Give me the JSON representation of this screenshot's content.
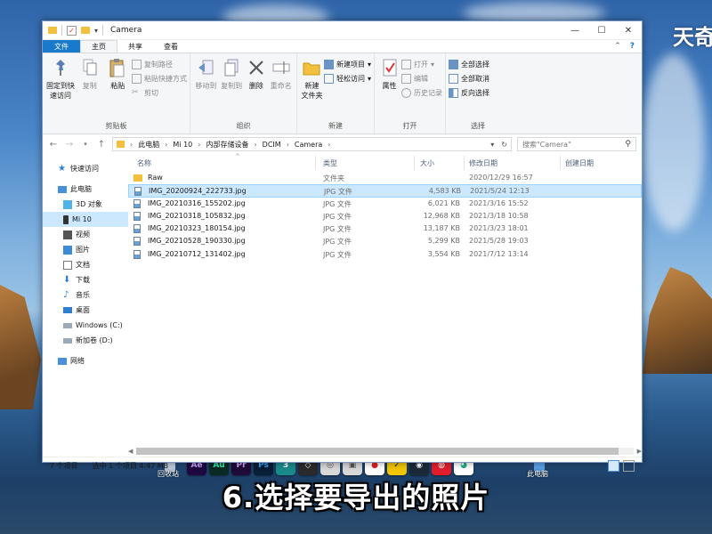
{
  "window": {
    "title": "Camera",
    "controls": {
      "minimize": "—",
      "maximize": "☐",
      "close": "✕"
    }
  },
  "menu_tabs": [
    "文件",
    "主页",
    "共享",
    "查看"
  ],
  "ribbon": {
    "clipboard": {
      "label": "剪贴板",
      "pin": "固定到快速访问",
      "copy": "复制",
      "paste": "粘贴",
      "copy_path": "复制路径",
      "paste_shortcut": "粘贴快捷方式",
      "cut": "剪切"
    },
    "organize": {
      "label": "组织",
      "move_to": "移动到",
      "copy_to": "复制到",
      "delete": "删除",
      "rename": "重命名"
    },
    "new": {
      "label": "新建",
      "new_folder": "新建\n文件夹",
      "new_item": "新建项目",
      "easy_access": "轻松访问"
    },
    "open": {
      "label": "打开",
      "properties": "属性",
      "open": "打开",
      "edit": "编辑",
      "history": "历史记录"
    },
    "select": {
      "label": "选择",
      "select_all": "全部选择",
      "select_none": "全部取消",
      "invert": "反向选择"
    }
  },
  "address": {
    "crumbs": [
      "此电脑",
      "Mi 10",
      "内部存储设备",
      "DCIM",
      "Camera"
    ],
    "search_placeholder": "搜索\"Camera\""
  },
  "nav": {
    "quick_access": "快速访问",
    "this_pc": "此电脑",
    "items": [
      "3D 对象",
      "Mi 10",
      "视频",
      "图片",
      "文档",
      "下载",
      "音乐",
      "桌面",
      "Windows (C:)",
      "新加卷 (D:)"
    ],
    "network": "网络"
  },
  "columns": {
    "name": "名称",
    "type": "类型",
    "size": "大小",
    "modified": "修改日期",
    "created": "创建日期"
  },
  "files": [
    {
      "name": "Raw",
      "type": "文件夹",
      "size": "",
      "modified": "2020/12/29 16:57",
      "kind": "folder"
    },
    {
      "name": "IMG_20200924_222733.jpg",
      "type": "JPG 文件",
      "size": "4,583 KB",
      "modified": "2021/5/24 12:13",
      "kind": "jpg"
    },
    {
      "name": "IMG_20210316_155202.jpg",
      "type": "JPG 文件",
      "size": "6,021 KB",
      "modified": "2021/3/16 15:52",
      "kind": "jpg"
    },
    {
      "name": "IMG_20210318_105832.jpg",
      "type": "JPG 文件",
      "size": "12,968 KB",
      "modified": "2021/3/18 10:58",
      "kind": "jpg"
    },
    {
      "name": "IMG_20210323_180154.jpg",
      "type": "JPG 文件",
      "size": "13,187 KB",
      "modified": "2021/3/23 18:01",
      "kind": "jpg"
    },
    {
      "name": "IMG_20210528_190330.jpg",
      "type": "JPG 文件",
      "size": "5,299 KB",
      "modified": "2021/5/28 19:03",
      "kind": "jpg"
    },
    {
      "name": "IMG_20210712_131402.jpg",
      "type": "JPG 文件",
      "size": "3,554 KB",
      "modified": "2021/7/12 13:14",
      "kind": "jpg"
    }
  ],
  "selected_row": 1,
  "status": {
    "count": "7 个项目",
    "selection": "选中 1 个项目  4.47 MB"
  },
  "desktop": {
    "watermark": "天奇",
    "caption": "6.选择要导出的照片",
    "recycle_bin": "回收站",
    "this_pc_icon": "此电脑",
    "taskbar_apps": [
      "Ae",
      "Au",
      "Pr",
      "Ps",
      "3ds Max",
      "Unity",
      "Steam-like",
      "Tool",
      "Pokeball",
      "Norton",
      "Steam",
      "Netease Music",
      "Chrome"
    ]
  },
  "colors": {
    "accent": "#1979ca",
    "selection": "#cce8ff",
    "folder": "#f3c03e"
  }
}
